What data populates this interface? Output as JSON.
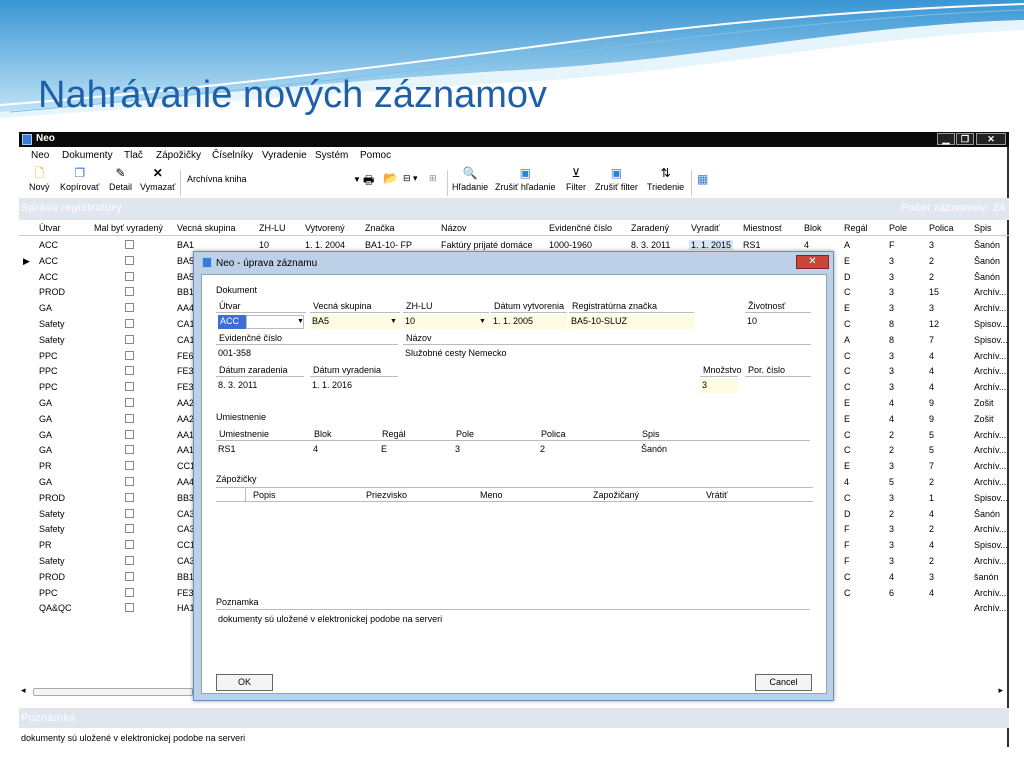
{
  "slide": {
    "title": "Nahrávanie nových záznamov"
  },
  "window": {
    "title": "Neo"
  },
  "menu": [
    "Neo",
    "Dokumenty",
    "Tlač",
    "Zápožičky",
    "Číselníky",
    "Vyradenie",
    "Systém",
    "Pomoc"
  ],
  "toolbar": {
    "novy": "Nový",
    "kopirovat": "Kopírovať",
    "detail": "Detail",
    "vymazat": "Vymazať",
    "book": "Archívna kniha",
    "hladanie": "Hľadanie",
    "zrusit_hladanie": "Zrušiť hľadanie",
    "filter": "Filter",
    "zrusit_filter": "Zrušiť filter",
    "triedenie": "Triedenie"
  },
  "grid": {
    "section_label": "Správa registratúry",
    "right_label": "Počet záznamov: 24",
    "columns": [
      "Útvar",
      "Mal byť vyradený",
      "Vecná skupina",
      "ZH-LU",
      "Vytvorený",
      "Značka",
      "Názov",
      "Evidenčné číslo",
      "Zaradený",
      "Vyradiť",
      "Miestnosť",
      "Blok",
      "Regál",
      "Pole",
      "Polica",
      "Spis"
    ],
    "rows": [
      {
        "utvar": "ACC",
        "vs": "BA1",
        "zhlu": "10",
        "vytv": "1. 1. 2004",
        "znacka": "BA1-10- FP",
        "nazov": "Faktúry prijaté domáce",
        "ev": "1000-1960",
        "zar": "8. 3. 2011",
        "vyr": "1. 1. 2015",
        "miest": "RS1",
        "blok": "4",
        "regal": "A",
        "pole": "F",
        "polica": "3",
        "spis": "Šanón"
      },
      {
        "utvar": "ACC",
        "vs": "BA5",
        "regal": "E",
        "pole": "3",
        "polica": "2",
        "spis": "Šanón",
        "selected": true
      },
      {
        "utvar": "ACC",
        "vs": "BA5",
        "regal": "D",
        "pole": "3",
        "polica": "2",
        "spis": "Šanón"
      },
      {
        "utvar": "PROD",
        "vs": "BB1",
        "regal": "C",
        "pole": "3",
        "polica": "15",
        "spis": "Archív..."
      },
      {
        "utvar": "GA",
        "vs": "AA4",
        "regal": "E",
        "pole": "3",
        "polica": "3",
        "spis": "Archív..."
      },
      {
        "utvar": "Safety",
        "vs": "CA1",
        "regal": "C",
        "pole": "8",
        "polica": "12",
        "spis": "Spisov..."
      },
      {
        "utvar": "Safety",
        "vs": "CA1",
        "regal": "A",
        "pole": "8",
        "polica": "7",
        "spis": "Spisov..."
      },
      {
        "utvar": "PPC",
        "vs": "FE6",
        "regal": "C",
        "pole": "3",
        "polica": "4",
        "spis": "Archív..."
      },
      {
        "utvar": "PPC",
        "vs": "FE3",
        "regal": "C",
        "pole": "3",
        "polica": "4",
        "spis": "Archív..."
      },
      {
        "utvar": "PPC",
        "vs": "FE3",
        "regal": "C",
        "pole": "3",
        "polica": "4",
        "spis": "Archív..."
      },
      {
        "utvar": "GA",
        "vs": "AA2",
        "regal": "E",
        "pole": "4",
        "polica": "9",
        "spis": "Zošit"
      },
      {
        "utvar": "GA",
        "vs": "AA2",
        "regal": "E",
        "pole": "4",
        "polica": "9",
        "spis": "Zošiť"
      },
      {
        "utvar": "GA",
        "vs": "AA1",
        "regal": "C",
        "pole": "2",
        "polica": "5",
        "spis": "Archív..."
      },
      {
        "utvar": "GA",
        "vs": "AA1",
        "regal": "C",
        "pole": "2",
        "polica": "5",
        "spis": "Archív..."
      },
      {
        "utvar": "PR",
        "vs": "CC1",
        "regal": "E",
        "pole": "3",
        "polica": "7",
        "spis": "Archív..."
      },
      {
        "utvar": "GA",
        "vs": "AA4",
        "regal": "4",
        "pole": "5",
        "polica": "2",
        "spis": "Archív..."
      },
      {
        "utvar": "PROD",
        "vs": "BB3",
        "regal": "C",
        "pole": "3",
        "polica": "1",
        "spis": "Spisov..."
      },
      {
        "utvar": "Safety",
        "vs": "CA3",
        "regal": "D",
        "pole": "2",
        "polica": "4",
        "spis": "Šanón"
      },
      {
        "utvar": "Safety",
        "vs": "CA3",
        "regal": "F",
        "pole": "3",
        "polica": "2",
        "spis": "Archív..."
      },
      {
        "utvar": "PR",
        "vs": "CC1",
        "regal": "F",
        "pole": "3",
        "polica": "4",
        "spis": "Spisov..."
      },
      {
        "utvar": "Safety",
        "vs": "CA3",
        "regal": "F",
        "pole": "3",
        "polica": "2",
        "spis": "Archív..."
      },
      {
        "utvar": "PROD",
        "vs": "BB1",
        "regal": "C",
        "pole": "4",
        "polica": "3",
        "spis": "šanón"
      },
      {
        "utvar": "PPC",
        "vs": "FE3",
        "regal": "C",
        "pole": "6",
        "polica": "4",
        "spis": "Archív..."
      },
      {
        "utvar": "QA&QC",
        "vs": "HA1",
        "spis": "Archív..."
      }
    ]
  },
  "bottom": {
    "label": "Poznámka",
    "text": "dokumenty sú uložené v elektronickej podobe na serveri"
  },
  "dialog": {
    "title": "Neo - úprava záznamu",
    "section_dokument": "Dokument",
    "l_utvar": "Útvar",
    "v_utvar": "ACC",
    "l_vs": "Vecná skupina",
    "v_vs": "BA5",
    "l_zhlu": "ZH-LU",
    "v_zhlu": "10",
    "l_dvytv": "Dátum vytvorenia",
    "v_dvytv": "1. 1. 2005",
    "l_reg": "Registratúrna značka",
    "v_reg": "BA5-10-SLUZ",
    "l_ziv": "Životnosť",
    "v_ziv": "10",
    "l_ev": "Evidenčné číslo",
    "v_ev": "001-358",
    "l_nazov": "Názov",
    "v_nazov": "Služobné cesty Nemecko",
    "l_dzar": "Dátum zaradenia",
    "v_dzar": "8. 3. 2011",
    "l_dvyr": "Dátum vyradenia",
    "v_dvyr": "1. 1. 2016",
    "l_mn": "Množstvo",
    "v_mn": "3",
    "l_por": "Por. číslo",
    "section_umiest": "Umiestnenie",
    "l_u_umiest": "Umiestnenie",
    "v_u_umiest": "RS1",
    "l_blok": "Blok",
    "v_blok": "4",
    "l_regal": "Regál",
    "v_regal": "E",
    "l_pole": "Pole",
    "v_pole": "3",
    "l_polica": "Polica",
    "v_polica": "2",
    "l_spis": "Spis",
    "v_spis": "Šanón",
    "section_zap": "Zápožičky",
    "zap_cols": [
      "Popis",
      "Priezvisko",
      "Meno",
      "Zapožičaný",
      "Vrátiť"
    ],
    "section_poz": "Poznamka",
    "v_poz": "dokumenty sú uložené v elektronickej podobe na serveri",
    "ok": "OK",
    "cancel": "Cancel"
  },
  "colors": {
    "title_blue": "#1f5fa8",
    "selection": "#3b6fd4",
    "dialog_frame": "#bcd0e8",
    "close_red": "#c9463d"
  }
}
